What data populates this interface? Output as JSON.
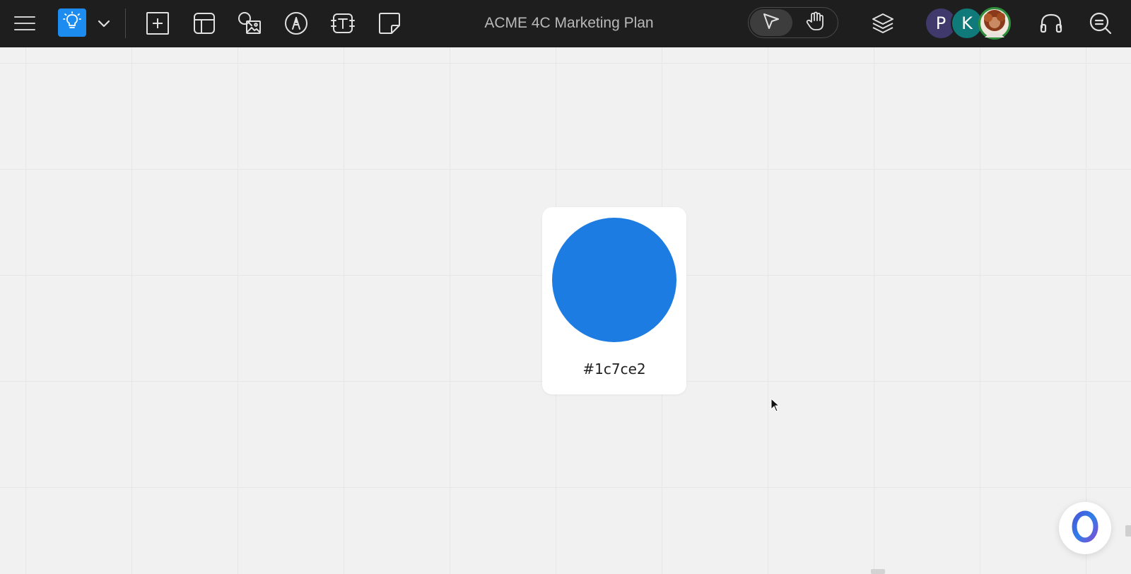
{
  "header": {
    "title": "ACME 4C Marketing Plan",
    "accent_color": "#1c8cf0",
    "icons": {
      "menu": "hamburger-menu-icon",
      "idea": "lightbulb-icon",
      "idea_dropdown": "chevron-down-icon",
      "add": "add-box-icon",
      "template": "layout-template-icon",
      "media": "image-search-icon",
      "pen": "pen-tool-icon",
      "text": "text-box-icon",
      "sticky": "sticky-note-icon",
      "select": "pointer-arrow-icon",
      "pan": "hand-icon",
      "layers": "layers-icon",
      "audio": "headphones-icon",
      "zoom": "zoom-out-icon"
    },
    "mode": {
      "active": "select"
    },
    "collaborators": [
      {
        "initial": "P",
        "color": "#3f3a6b"
      },
      {
        "initial": "K",
        "color": "#0f7a79"
      },
      {
        "initial": "",
        "color": "#2e8f3d",
        "type": "photo"
      }
    ]
  },
  "canvas": {
    "background": "#f1f1f1",
    "swatch": {
      "color": "#1c7ce2",
      "label": "#1c7ce2"
    },
    "assistant_icon": "ai-assistant-ring-icon"
  }
}
